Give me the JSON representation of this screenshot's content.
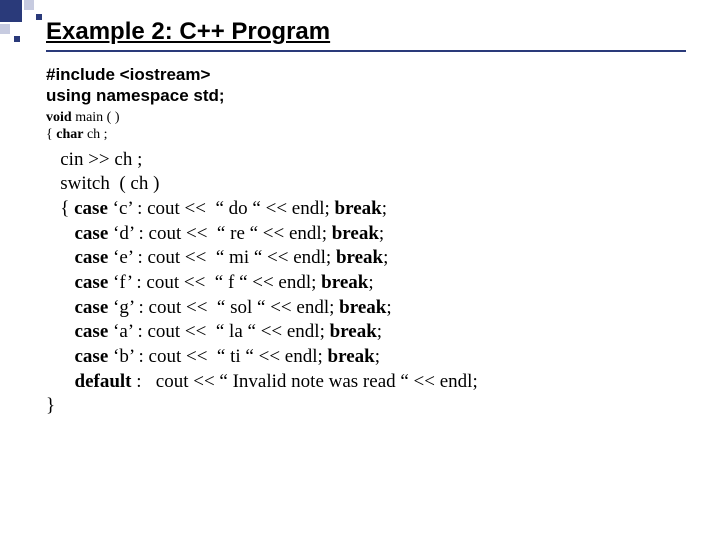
{
  "title": "Example 2: C++ Program",
  "includes": {
    "line1": "#include <iostream>",
    "line2": "using namespace std;"
  },
  "signature": {
    "void": "void",
    "main_rest": " main ( )",
    "brace": "{ ",
    "char": "char",
    "ch": " ch ;"
  },
  "code": {
    "cin": "   cin >> ch ;",
    "switch": "   switch  ( ch )",
    "open": "   { ",
    "case_kw": "case",
    "break_kw": "break",
    "default_kw": "default",
    "c_c": " ‘c’ : cout <<  “ do “ << endl; ",
    "c_d": " ‘d’ : cout <<  “ re “ << endl; ",
    "c_e": " ‘e’ : cout <<  “ mi “ << endl; ",
    "c_f": " ‘f’ : cout <<  “ f “ << endl; ",
    "c_g": " ‘g’ : cout <<  “ sol “ << endl; ",
    "c_a": " ‘a’ : cout <<  “ la “ << endl; ",
    "c_b": " ‘b’ : cout <<  “ ti “ << endl; ",
    "def_rest": " :   cout << “ Invalid note was read “ << endl;",
    "semi": ";",
    "indent_case": "      ",
    "close": "}"
  }
}
